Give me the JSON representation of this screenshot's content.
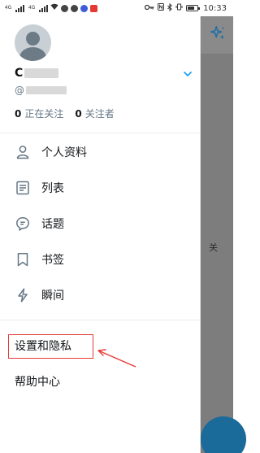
{
  "status_bar": {
    "net_label_1": "4G",
    "net_label_2": "4G",
    "time": "10:33",
    "battery_level": 0.75,
    "icons": [
      "signal-icon",
      "wifi-icon",
      "shield-icon",
      "app-icon",
      "notification-icon",
      "key-icon",
      "nfc-icon",
      "bluetooth-icon",
      "vibrate-icon",
      "battery-icon"
    ]
  },
  "profile": {
    "name_initial": "C",
    "handle_prefix": "@",
    "following_count": "0",
    "following_label": "正在关注",
    "followers_count": "0",
    "followers_label": "关注者"
  },
  "menu": {
    "items": [
      {
        "label": "个人资料",
        "icon": "person-icon"
      },
      {
        "label": "列表",
        "icon": "list-icon"
      },
      {
        "label": "话题",
        "icon": "topic-icon"
      },
      {
        "label": "书签",
        "icon": "bookmark-icon"
      },
      {
        "label": "瞬间",
        "icon": "lightning-icon"
      }
    ],
    "settings_label": "设置和隐私",
    "help_label": "帮助中心"
  },
  "background": {
    "partial_text": "关"
  },
  "colors": {
    "accent": "#1da1f2",
    "annotation": "#e53935",
    "text": "#14171a",
    "secondary_text": "#657786"
  }
}
